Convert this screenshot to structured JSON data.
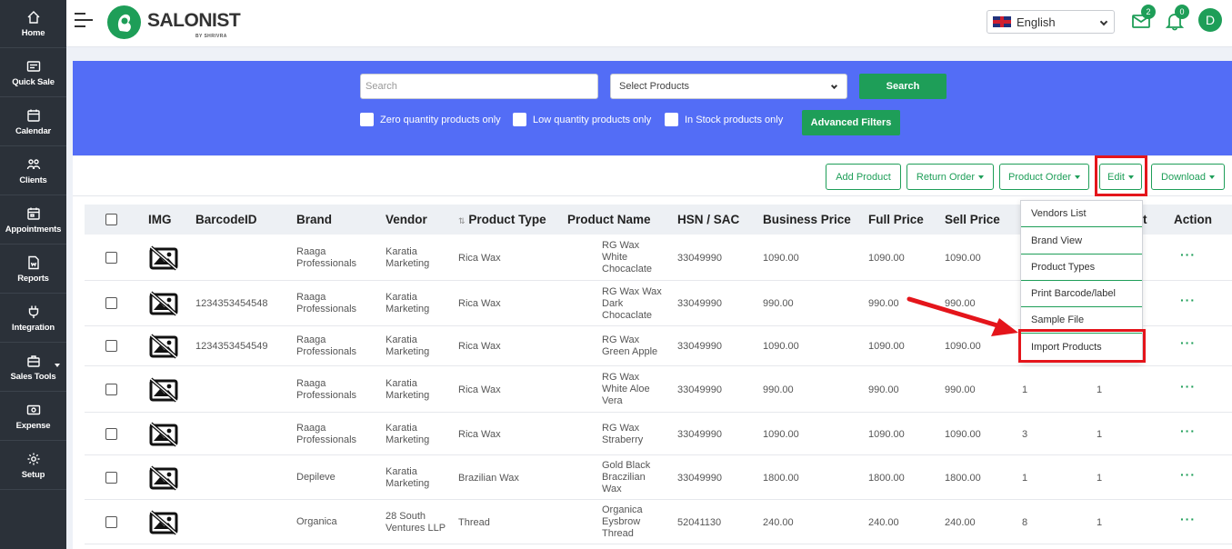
{
  "sidebar": {
    "items": [
      {
        "label": "Home",
        "icon": "home-icon"
      },
      {
        "label": "Quick Sale",
        "icon": "quick-sale-icon"
      },
      {
        "label": "Calendar",
        "icon": "calendar-icon"
      },
      {
        "label": "Clients",
        "icon": "clients-icon"
      },
      {
        "label": "Appointments",
        "icon": "appointments-icon"
      },
      {
        "label": "Reports",
        "icon": "reports-icon"
      },
      {
        "label": "Integration",
        "icon": "integration-icon"
      },
      {
        "label": "Sales Tools",
        "icon": "sales-tools-icon"
      },
      {
        "label": "Expense",
        "icon": "expense-icon"
      },
      {
        "label": "Setup",
        "icon": "setup-icon"
      }
    ]
  },
  "header": {
    "brand": "SALONIST",
    "brand_sub": "BY SHRIVRA",
    "language": "English",
    "mail_count": "2",
    "notification_count": "0",
    "avatar_initial": "D",
    "accent_color": "#1e9e58"
  },
  "filters": {
    "search_placeholder": "Search",
    "select_products": "Select Products",
    "search_button": "Search",
    "zero_qty": "Zero quantity products only",
    "low_qty": "Low quantity products only",
    "in_stock": "In Stock products only",
    "advanced_button": "Advanced Filters",
    "panel_color": "#536df6"
  },
  "toolbar": {
    "add_product": "Add Product",
    "return_order": "Return Order",
    "product_order": "Product Order",
    "edit": "Edit",
    "download": "Download"
  },
  "edit_menu": {
    "items": [
      "Vendors List",
      "Brand View",
      "Product Types",
      "Print Barcode/label",
      "Sample File",
      "Import Products"
    ]
  },
  "table": {
    "columns": [
      "IMG",
      "BarcodeID",
      "Brand",
      "Vendor",
      "Product Type",
      "Product Name",
      "HSN / SAC",
      "Business Price",
      "Full Price",
      "Sell Price",
      "t",
      "Action"
    ],
    "sort_glyph": "⇅",
    "action_glyph": "···",
    "rows": [
      {
        "barcode": "",
        "brand": [
          "Raaga",
          "Professionals"
        ],
        "vendor": [
          "Karatia",
          "Marketing"
        ],
        "type": "Rica Wax",
        "name": [
          "RG Wax",
          "White",
          "Chocaclate"
        ],
        "hsn": "33049990",
        "business": "1090.00",
        "full": "1090.00",
        "sell": "1090.00",
        "c1": "",
        "c2": ""
      },
      {
        "barcode": "1234353454548",
        "brand": [
          "Raaga",
          "Professionals"
        ],
        "vendor": [
          "Karatia",
          "Marketing"
        ],
        "type": "Rica Wax",
        "name": [
          "RG Wax Wax",
          "Dark",
          "Chocaclate"
        ],
        "hsn": "33049990",
        "business": "990.00",
        "full": "990.00",
        "sell": "990.00",
        "c1": "",
        "c2": ""
      },
      {
        "barcode": "1234353454549",
        "brand": [
          "Raaga",
          "Professionals"
        ],
        "vendor": [
          "Karatia",
          "Marketing"
        ],
        "type": "Rica Wax",
        "name": [
          "RG Wax",
          "Green Apple"
        ],
        "hsn": "33049990",
        "business": "1090.00",
        "full": "1090.00",
        "sell": "1090.00",
        "c1": "",
        "c2": ""
      },
      {
        "barcode": "",
        "brand": [
          "Raaga",
          "Professionals"
        ],
        "vendor": [
          "Karatia",
          "Marketing"
        ],
        "type": "Rica Wax",
        "name": [
          "RG Wax",
          "White Aloe",
          "Vera"
        ],
        "hsn": "33049990",
        "business": "990.00",
        "full": "990.00",
        "sell": "990.00",
        "c1": "1",
        "c2": "1"
      },
      {
        "barcode": "",
        "brand": [
          "Raaga",
          "Professionals"
        ],
        "vendor": [
          "Karatia",
          "Marketing"
        ],
        "type": "Rica Wax",
        "name": [
          "RG Wax",
          "Straberry"
        ],
        "hsn": "33049990",
        "business": "1090.00",
        "full": "1090.00",
        "sell": "1090.00",
        "c1": "3",
        "c2": "1"
      },
      {
        "barcode": "",
        "brand": [
          "Depileve"
        ],
        "vendor": [
          "Karatia",
          "Marketing"
        ],
        "type": "Brazilian Wax",
        "name": [
          "Gold Black",
          "Braczilian",
          "Wax"
        ],
        "hsn": "33049990",
        "business": "1800.00",
        "full": "1800.00",
        "sell": "1800.00",
        "c1": "1",
        "c2": "1"
      },
      {
        "barcode": "",
        "brand": [
          "Organica"
        ],
        "vendor": [
          "28 South",
          "Ventures LLP"
        ],
        "type": "Thread",
        "name": [
          "Organica",
          "Eysbrow",
          "Thread"
        ],
        "hsn": "52041130",
        "business": "240.00",
        "full": "240.00",
        "sell": "240.00",
        "c1": "8",
        "c2": "1"
      }
    ]
  }
}
